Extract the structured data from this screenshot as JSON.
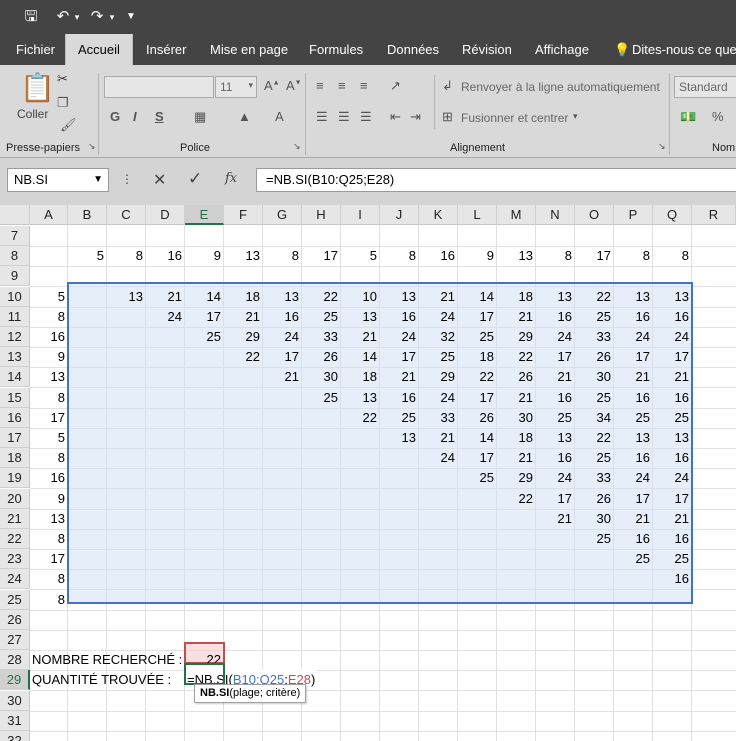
{
  "ribbon": {
    "tabs": [
      "Fichier",
      "Accueil",
      "Insérer",
      "Mise en page",
      "Formules",
      "Données",
      "Révision",
      "Affichage"
    ],
    "tell_me": "Dites-nous ce que v",
    "clipboard": {
      "paste_label": "Coller",
      "group_label": "Presse-papiers"
    },
    "font": {
      "size": "11",
      "group_label": "Police"
    },
    "alignment": {
      "wrap_label": "Renvoyer à la ligne automatiquement",
      "merge_label": "Fusionner et centrer",
      "group_label": "Alignement"
    },
    "number": {
      "format": "Standard",
      "group_label": "Nom"
    }
  },
  "formula_bar": {
    "name_box": "NB.SI",
    "fx": "fx",
    "formula": "=NB.SI(B10:Q25;E28)"
  },
  "columns": [
    "A",
    "B",
    "C",
    "D",
    "E",
    "F",
    "G",
    "H",
    "I",
    "J",
    "K",
    "L",
    "M",
    "N",
    "O",
    "P",
    "Q",
    "R"
  ],
  "rows": [
    "7",
    "8",
    "9",
    "10",
    "11",
    "12",
    "13",
    "14",
    "15",
    "16",
    "17",
    "18",
    "19",
    "20",
    "21",
    "22",
    "23",
    "24",
    "25",
    "26",
    "27",
    "28",
    "29",
    "30",
    "31",
    "32"
  ],
  "row8": [
    "5",
    "8",
    "16",
    "9",
    "13",
    "8",
    "17",
    "5",
    "8",
    "16",
    "9",
    "13",
    "8",
    "17",
    "8",
    "8"
  ],
  "colA": [
    "5",
    "8",
    "16",
    "9",
    "13",
    "8",
    "17",
    "5",
    "8",
    "16",
    "9",
    "13",
    "8",
    "17",
    "8",
    "8"
  ],
  "triangle": [
    [
      "13",
      "21",
      "14",
      "18",
      "13",
      "22",
      "10",
      "13",
      "21",
      "14",
      "18",
      "13",
      "22",
      "13",
      "13"
    ],
    [
      "24",
      "17",
      "21",
      "16",
      "25",
      "13",
      "16",
      "24",
      "17",
      "21",
      "16",
      "25",
      "16",
      "16"
    ],
    [
      "25",
      "29",
      "24",
      "33",
      "21",
      "24",
      "32",
      "25",
      "29",
      "24",
      "33",
      "24",
      "24"
    ],
    [
      "22",
      "17",
      "26",
      "14",
      "17",
      "25",
      "18",
      "22",
      "17",
      "26",
      "17",
      "17"
    ],
    [
      "21",
      "30",
      "18",
      "21",
      "29",
      "22",
      "26",
      "21",
      "30",
      "21",
      "21"
    ],
    [
      "25",
      "13",
      "16",
      "24",
      "17",
      "21",
      "16",
      "25",
      "16",
      "16"
    ],
    [
      "22",
      "25",
      "33",
      "26",
      "30",
      "25",
      "34",
      "25",
      "25"
    ],
    [
      "13",
      "21",
      "14",
      "18",
      "13",
      "22",
      "13",
      "13"
    ],
    [
      "24",
      "17",
      "21",
      "16",
      "25",
      "16",
      "16"
    ],
    [
      "25",
      "29",
      "24",
      "33",
      "24",
      "24"
    ],
    [
      "22",
      "17",
      "26",
      "17",
      "17"
    ],
    [
      "21",
      "30",
      "21",
      "21"
    ],
    [
      "25",
      "16",
      "16"
    ],
    [
      "25",
      "25"
    ],
    [
      "16"
    ]
  ],
  "labels": {
    "searched": "NOMBRE RECHERCHÉ :",
    "found": "QUANTITÉ TROUVÉE :",
    "searched_value": "22",
    "edit_eq": "=NB.SI(",
    "edit_range": "B10:Q25",
    "edit_sep": ";",
    "edit_crit": "E28",
    "edit_close": ")",
    "tooltip_fn": "NB.SI",
    "tooltip_args": "(plage; critère)"
  },
  "colors": {
    "accent": "#217346",
    "range_blue": "#4472c4",
    "crit_red": "#c0504d"
  }
}
